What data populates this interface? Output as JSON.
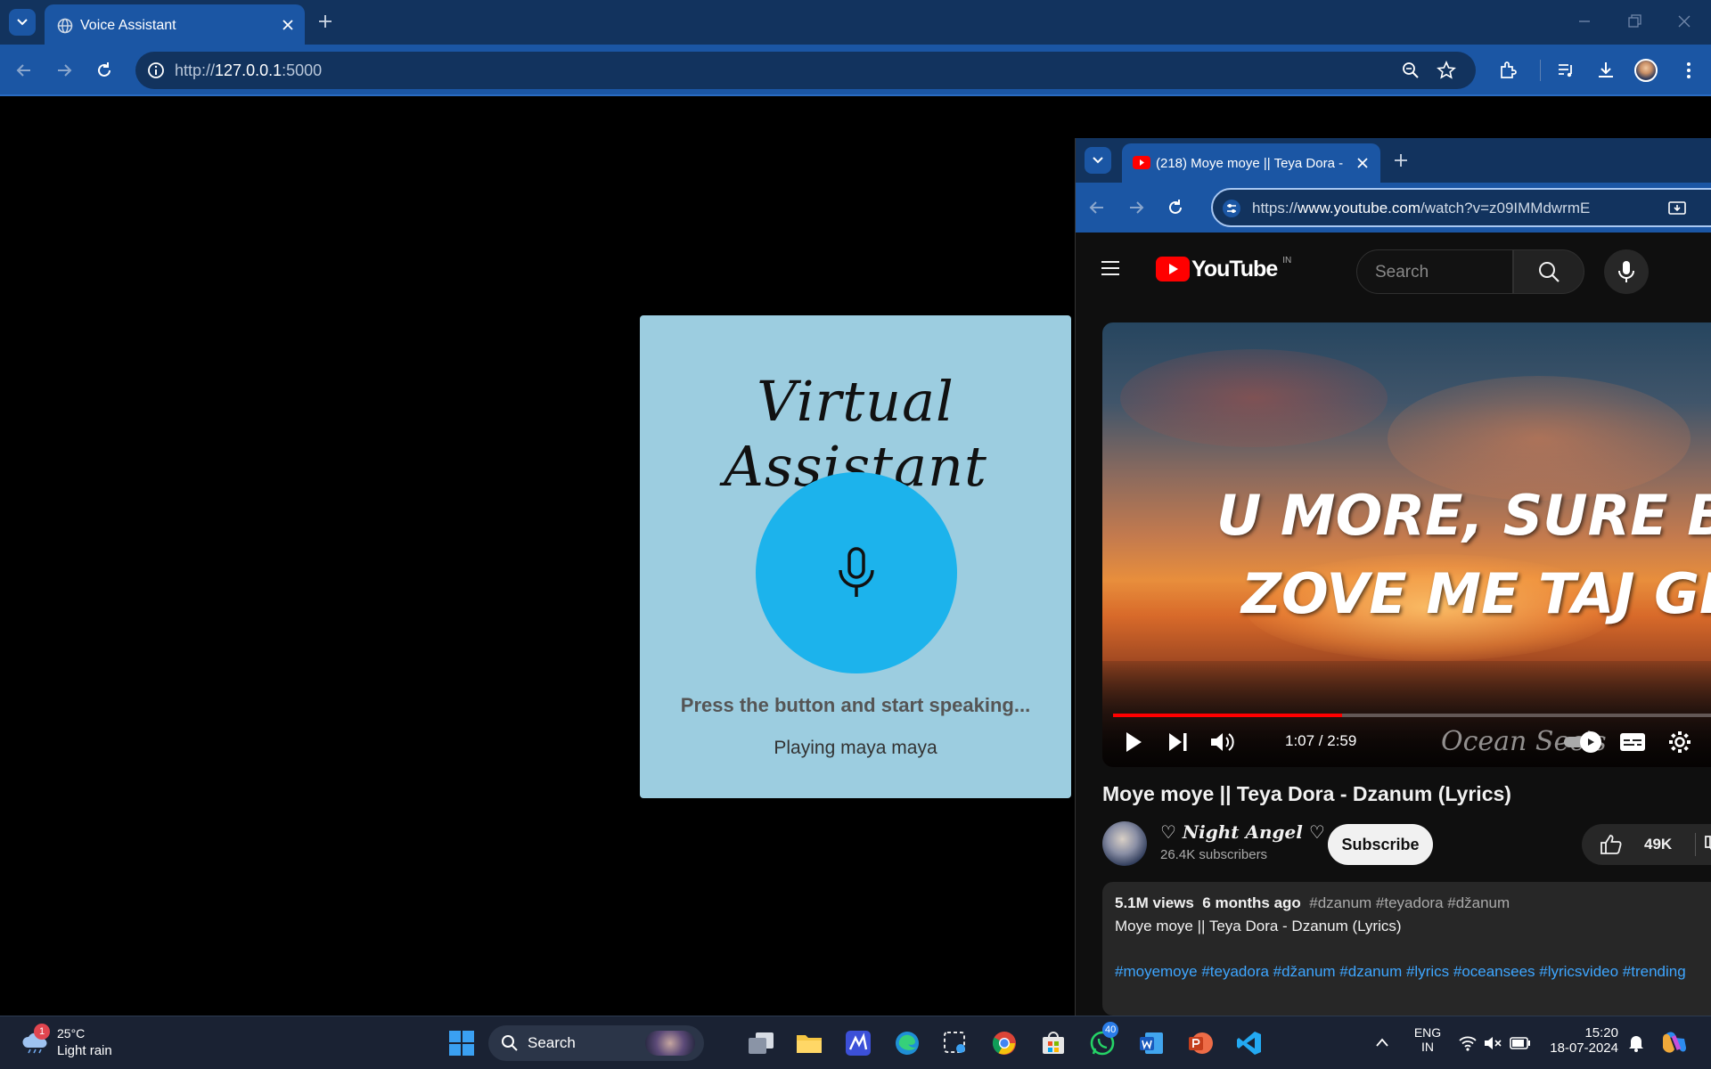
{
  "browser": {
    "tab_title": "Voice Assistant",
    "url_scheme": "http://",
    "url_host": "127.0.0.1",
    "url_rest": ":5000",
    "accent_color": "#1b56a4"
  },
  "assistant": {
    "title": "Virtual Assistant",
    "prompt": "Press the button and start speaking...",
    "status": "Playing maya maya",
    "card_color": "#9ccde0",
    "button_color": "#1cb3ec"
  },
  "youtube_window": {
    "tab_title": "(218) Moye moye || Teya Dora -",
    "url_prefix": "https://",
    "url_host": "www.youtube.com",
    "url_path": "/watch?v=z09IMMdwrmE",
    "logo_text": "YouTube",
    "region": "IN",
    "search_placeholder": "Search",
    "lyric_line1": "U MORE, SURE BOJE",
    "lyric_line2": "ZOVE ME TAJ GLAS",
    "time": "1:07 / 2:59",
    "progress": 0.374,
    "watermark": "Ocean See's",
    "video_title": "Moye moye || Teya Dora - Dzanum (Lyrics)",
    "channel_name": "♡ Night Angel ♡",
    "subscribers": "26.4K subscribers",
    "subscribe_label": "Subscribe",
    "likes": "49K",
    "views": "5.1M views",
    "uploaded": "6 months ago",
    "tags": "#dzanum #teyadora #džanum",
    "description": "Moye moye || Teya Dora - Dzanum (Lyrics)",
    "hashtags": "#moyemoye #teyadora #džanum #dzanum #lyrics #oceansees #lyricsvideo #trending"
  },
  "taskbar": {
    "weather_temp": "25°C",
    "weather_desc": "Light rain",
    "weather_badge": "1",
    "search_label": "Search",
    "whatsapp_badge": "40",
    "lang_top": "ENG",
    "lang_bottom": "IN",
    "clock_time": "15:20",
    "clock_date": "18-07-2024"
  }
}
